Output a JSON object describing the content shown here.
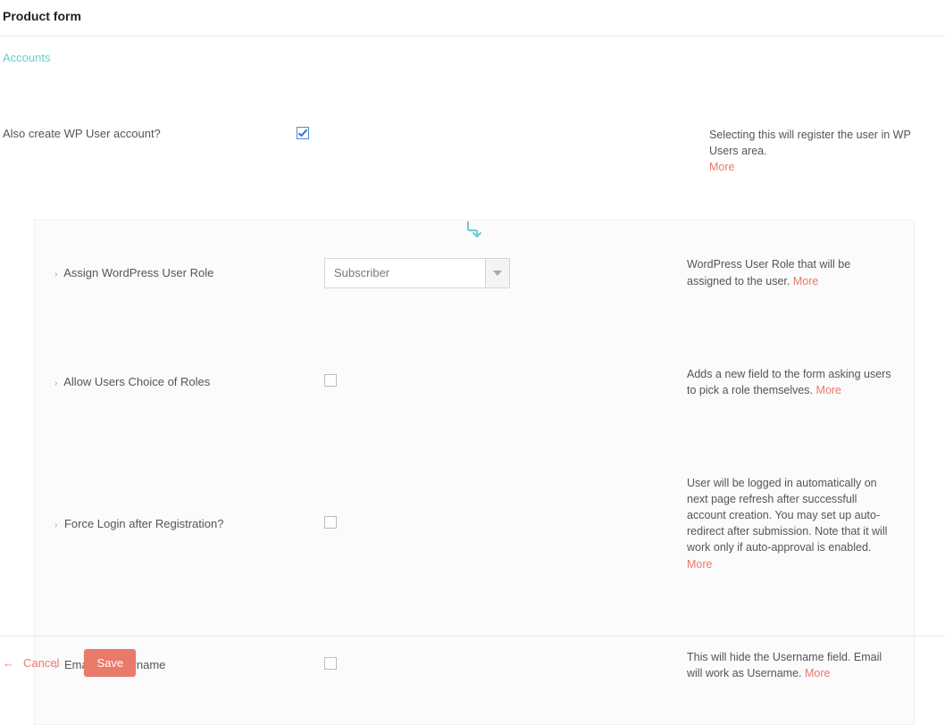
{
  "title": "Product form",
  "section": "Accounts",
  "more_label": "More",
  "top_field": {
    "label": "Also create WP User account?",
    "checked": true,
    "description": "Selecting this will register the user in WP Users area."
  },
  "fields": [
    {
      "label": "Assign WordPress User Role",
      "type": "select",
      "value": "Subscriber",
      "description": "WordPress User Role that will be assigned to the user."
    },
    {
      "label": "Allow Users Choice of Roles",
      "type": "checkbox",
      "checked": false,
      "description": "Adds a new field to the form asking users to pick a role themselves."
    },
    {
      "label": "Force Login after Registration?",
      "type": "checkbox",
      "checked": false,
      "description": "User will be logged in automatically on next page refresh after successfull account creation. You may set up auto-redirect after submission. Note that it will work only if auto-approval is enabled."
    },
    {
      "label": "Email as Username",
      "type": "checkbox",
      "checked": false,
      "description": "This will hide the Username field. Email will work as Username."
    }
  ],
  "footer": {
    "cancel": "Cancel",
    "save": "Save"
  }
}
